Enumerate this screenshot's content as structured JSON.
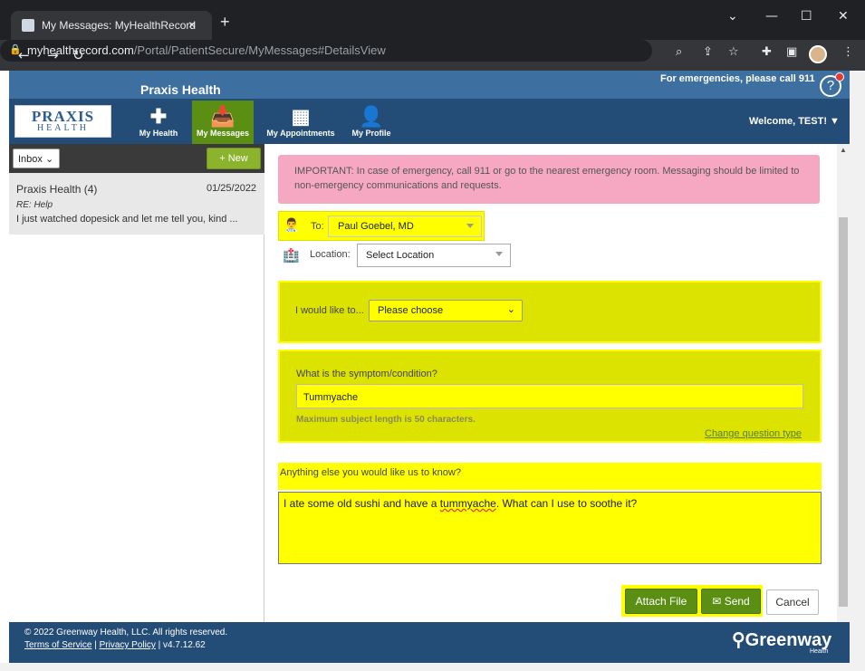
{
  "browser": {
    "tab_title": "My Messages: MyHealthRecord",
    "tab_close": "×",
    "new_tab": "+",
    "url_domain": "myhealthrecord.com",
    "url_path": "/Portal/PatientSecure/MyMessages#DetailsView",
    "win_min": "—",
    "win_max": "☐",
    "win_close": "✕",
    "win_down": "⌄"
  },
  "header": {
    "brand": "Praxis Health",
    "emergency": "For emergencies, please call 911",
    "help": "?",
    "logo_top": "PRAXIS",
    "logo_bottom": "HEALTH",
    "nav": [
      {
        "label": "My Health",
        "icon": "plus-icon"
      },
      {
        "label": "My Messages",
        "icon": "inbox-icon"
      },
      {
        "label": "My Appointments",
        "icon": "calendar-icon"
      },
      {
        "label": "My Profile",
        "icon": "person-icon"
      }
    ],
    "welcome": "Welcome, TEST! ▼"
  },
  "sidebar": {
    "folder": "Inbox",
    "new_button": "+ New",
    "messages": [
      {
        "from": "Praxis Health (4)",
        "date": "01/25/2022",
        "subject": "RE: Help",
        "preview": "I just watched dopesick and let me tell you, kind ..."
      }
    ]
  },
  "compose": {
    "alert": "IMPORTANT: In case of emergency, call 911 or go to the nearest emergency room. Messaging should be limited to non-emergency communications and requests.",
    "to_label": "To:",
    "to_value": "Paul Goebel, MD",
    "location_label": "Location:",
    "location_value": "Select Location",
    "like_label": "I would like to...",
    "like_value": "Please choose",
    "symptom_label": "What is the symptom/condition?",
    "symptom_value": "Tummyache",
    "symptom_hint": "Maximum subject length is 50 characters.",
    "change_question": "Change question type",
    "anything_label": "Anything else you would like us to know?",
    "body_pre": "I ate some old sushi and have a ",
    "body_word": "tummyache",
    "body_post": ". What can I use to soothe it?",
    "attach": "Attach File",
    "send": "Send",
    "cancel": "Cancel"
  },
  "footer": {
    "copyright": "© 2022 Greenway Health, LLC. All rights reserved.",
    "terms": "Terms of Service",
    "sep1": " | ",
    "privacy": "Privacy Policy",
    "version": " | v4.7.12.62",
    "brand": "Greenway",
    "brand_sub": "Health"
  },
  "colors": {
    "header_blue": "#3d6fa1",
    "nav_dark": "#234d76",
    "accent_green": "#5b8f13",
    "highlight_yellow": "#ffff00",
    "alert_pink": "#f6a8c2"
  }
}
